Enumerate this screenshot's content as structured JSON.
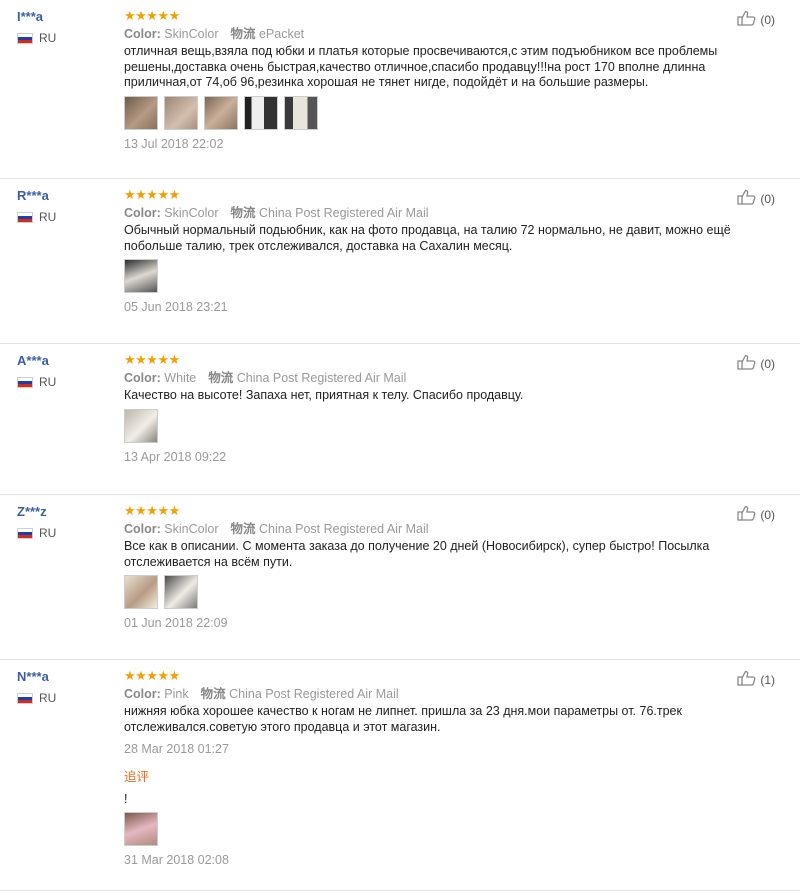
{
  "reviews": [
    {
      "user": "I***a",
      "country": "RU",
      "stars": "★★★★★",
      "color_label": "Color:",
      "color_value": "SkinColor",
      "logistics_label": "物流",
      "logistics_value": "ePacket",
      "text": "отличная вещь,взяла под юбки и платья которые просвечиваются,с этим подъюбником все проблемы решены,доставка очень быстрая,качество отличное,спасибо продавцу!!!на рост 170 вполне длинна приличная,от 74,об 96,резинка хорошая не тянет нигде, подойдёт и на большие размеры.",
      "photos": [
        "p1",
        "p2",
        "p3",
        "p4",
        "p5"
      ],
      "date": "13 Jul 2018 22:02",
      "likes": "(0)"
    },
    {
      "user": "R***a",
      "country": "RU",
      "stars": "★★★★★",
      "color_label": "Color:",
      "color_value": "SkinColor",
      "logistics_label": "物流",
      "logistics_value": "China Post Registered Air Mail",
      "text": "Обычный нормальный подьюбник, как на фото продавца, на талию 72 нормально, не давит, можно ещё побольше талию, трек отслеживался, доставка на Сахалин месяц.",
      "photos": [
        "p6"
      ],
      "date": "05 Jun 2018 23:21",
      "likes": "(0)"
    },
    {
      "user": "A***a",
      "country": "RU",
      "stars": "★★★★★",
      "color_label": "Color:",
      "color_value": "White",
      "logistics_label": "物流",
      "logistics_value": "China Post Registered Air Mail",
      "text": "Качество на высоте! Запаха нет, приятная к телу. Спасибо продавцу.",
      "photos": [
        "p7"
      ],
      "date": "13 Apr 2018 09:22",
      "likes": "(0)"
    },
    {
      "user": "Z***z",
      "country": "RU",
      "stars": "★★★★★",
      "color_label": "Color:",
      "color_value": "SkinColor",
      "logistics_label": "物流",
      "logistics_value": "China Post Registered Air Mail",
      "text": "Все как в описании. С момента заказа до получение 20 дней (Новосибирск), супер быстро! Посылка отслеживается на всём пути.",
      "photos": [
        "p8",
        "p9"
      ],
      "date": "01 Jun 2018 22:09",
      "likes": "(0)"
    },
    {
      "user": "N***a",
      "country": "RU",
      "stars": "★★★★★",
      "color_label": "Color:",
      "color_value": "Pink",
      "logistics_label": "物流",
      "logistics_value": "China Post Registered Air Mail",
      "text": "нижняя юбка хорошее качество к ногам не липнет. пришла за 23 дня.мои параметры от. 76.трек отслеживался.советую этого продавца и этот магазин.",
      "photos": [],
      "date": "28 Mar 2018 01:27",
      "likes": "(1)",
      "append": {
        "label": "追评",
        "text": "!",
        "photos": [
          "p10"
        ],
        "date": "31 Mar 2018 02:08"
      }
    }
  ]
}
